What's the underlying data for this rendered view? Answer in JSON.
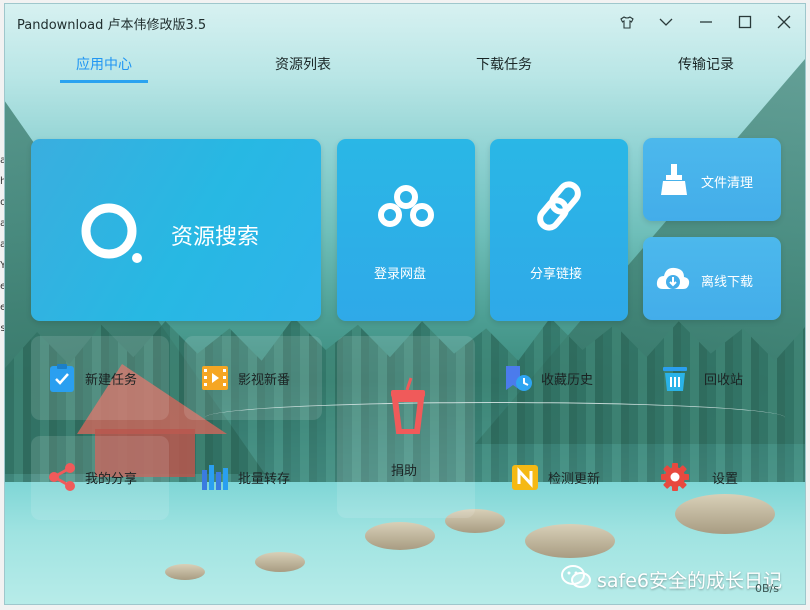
{
  "window": {
    "title": "Pandownload 卢本伟修改版3.5",
    "controls": [
      "skin-icon",
      "chevron-down-icon",
      "minimize-icon",
      "maximize-icon",
      "close-icon"
    ]
  },
  "tabs": [
    {
      "label": "应用中心",
      "active": true
    },
    {
      "label": "资源列表",
      "active": false
    },
    {
      "label": "下载任务",
      "active": false
    },
    {
      "label": "传输记录",
      "active": false
    }
  ],
  "tiles": {
    "search": "资源搜索",
    "login": "登录网盘",
    "share_link": "分享链接",
    "cleanup": "文件清理",
    "offline": "离线下载"
  },
  "row1": {
    "new_task": "新建任务",
    "new_shows": "影视新番",
    "donate": "捐助",
    "history": "收藏历史",
    "recycle": "回收站"
  },
  "row2": {
    "my_share": "我的分享",
    "batch_transfer": "批量转存",
    "check_update": "检测更新",
    "settings": "设置"
  },
  "watermark": "safe6安全的成长日记",
  "speed": "0B/s",
  "behind_window": {
    "letters": [
      "a",
      "h",
      "o",
      "a",
      "a",
      "Y",
      "e",
      "e",
      "s"
    ]
  },
  "colors": {
    "accent": "#2196f3",
    "tile_blue": "#2ab7e6",
    "donate_red": "#f05a5a",
    "settings_red": "#e8493f",
    "update_yellow": "#f5b914"
  }
}
